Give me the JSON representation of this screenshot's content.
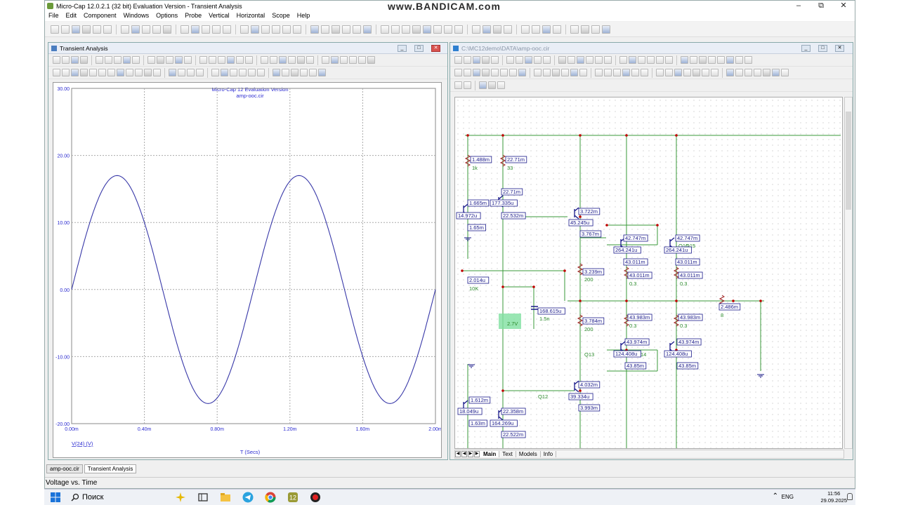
{
  "app": {
    "title": "Micro-Cap 12.0.2.1 (32 bit) Evaluation Version - Transient Analysis",
    "watermark": "www.BANDICAM.com",
    "menu": [
      "File",
      "Edit",
      "Component",
      "Windows",
      "Options",
      "Probe",
      "Vertical",
      "Horizontal",
      "Scope",
      "Help"
    ]
  },
  "left_window": {
    "title": "Transient Analysis"
  },
  "chart_data": {
    "type": "line",
    "title": "Micro-Cap 12 Evaluation Version",
    "subtitle": "amp-ooc.cir",
    "xlabel": "T (Secs)",
    "ylabel": "V(24) (V)",
    "xlim": [
      0,
      2.0
    ],
    "ylim": [
      -20,
      30
    ],
    "x_unit": "ms",
    "xticks": [
      "0.00m",
      "0.40m",
      "0.80m",
      "1.20m",
      "1.60m",
      "2.00m"
    ],
    "yticks": [
      "30.00",
      "20.00",
      "10.00",
      "0.00",
      "-10.00",
      "-20.00"
    ],
    "grid": true,
    "series": [
      {
        "name": "V(24) (V)",
        "color": "#2b2bbf",
        "amplitude": 17.0,
        "offset": 0.0,
        "frequency_khz": 1.0,
        "phase_deg": 0
      }
    ]
  },
  "right_window": {
    "title": "C:\\MC12demo\\DATA\\amp-ooc.cir",
    "tabs": [
      "Main",
      "Text",
      "Models",
      "Info"
    ],
    "active_tab": "Main"
  },
  "schematic": {
    "labels": [
      {
        "t": "1.488m",
        "box": true
      },
      {
        "t": "22.71m",
        "box": true
      },
      {
        "t": "1k",
        "box": false
      },
      {
        "t": "33",
        "box": false
      },
      {
        "t": "22.71m",
        "box": true
      },
      {
        "t": "1.665m",
        "box": true
      },
      {
        "t": "177.335u",
        "box": true
      },
      {
        "t": "14.972u",
        "box": true
      },
      {
        "t": "22.532m",
        "box": true
      },
      {
        "t": "1.65m",
        "box": true
      },
      {
        "t": "3.722m",
        "box": true
      },
      {
        "t": "45.245u",
        "box": true
      },
      {
        "t": "3.767m",
        "box": true
      },
      {
        "t": "42.747m",
        "box": true
      },
      {
        "t": "42.747m",
        "box": true
      },
      {
        "t": "Q15",
        "box": false
      },
      {
        "t": "Q16",
        "box": false
      },
      {
        "t": "264.241u",
        "box": true
      },
      {
        "t": "264.241u",
        "box": true
      },
      {
        "t": "43.011m",
        "box": true
      },
      {
        "t": "43.011m",
        "box": true
      },
      {
        "t": "3.239m",
        "box": true
      },
      {
        "t": "2.014u",
        "box": true
      },
      {
        "t": "10K",
        "box": false
      },
      {
        "t": "200",
        "box": false
      },
      {
        "t": "43.011m",
        "box": true
      },
      {
        "t": "43.011m",
        "box": true
      },
      {
        "t": "0.3",
        "box": false
      },
      {
        "t": "0.3",
        "box": false
      },
      {
        "t": "168.615u",
        "box": true
      },
      {
        "t": "1.5n",
        "box": false
      },
      {
        "t": "2.486m",
        "box": true
      },
      {
        "t": "8",
        "box": false
      },
      {
        "t": "2.7V",
        "box": false
      },
      {
        "t": "3.784m",
        "box": true
      },
      {
        "t": "43.983m",
        "box": true
      },
      {
        "t": "43.983m",
        "box": true
      },
      {
        "t": "200",
        "box": false
      },
      {
        "t": "0.3",
        "box": false
      },
      {
        "t": "0.3",
        "box": false
      },
      {
        "t": "43.974m",
        "box": true
      },
      {
        "t": "43.974m",
        "box": true
      },
      {
        "t": "Q13",
        "box": false
      },
      {
        "t": "14",
        "box": false
      },
      {
        "t": "124.408u",
        "box": true
      },
      {
        "t": "124.408u",
        "box": true
      },
      {
        "t": "43.85m",
        "box": true
      },
      {
        "t": "43.85m",
        "box": true
      },
      {
        "t": "4.032m",
        "box": true
      },
      {
        "t": "Q12",
        "box": false
      },
      {
        "t": "1.612m",
        "box": true
      },
      {
        "t": "39.334u",
        "box": true
      },
      {
        "t": "18.049u",
        "box": true
      },
      {
        "t": "22.358m",
        "box": true
      },
      {
        "t": "3.993m",
        "box": true
      },
      {
        "t": "1.63m",
        "box": true
      },
      {
        "t": "164.269u",
        "box": true
      },
      {
        "t": "22.522m",
        "box": true
      }
    ]
  },
  "doc_tabs": [
    "amp-ooc.cir",
    "Transient Analysis"
  ],
  "status": "Voltage vs. Time",
  "taskbar": {
    "search": "Поиск",
    "lang": "ENG",
    "time": "11:56",
    "date": "29.09.2025"
  }
}
